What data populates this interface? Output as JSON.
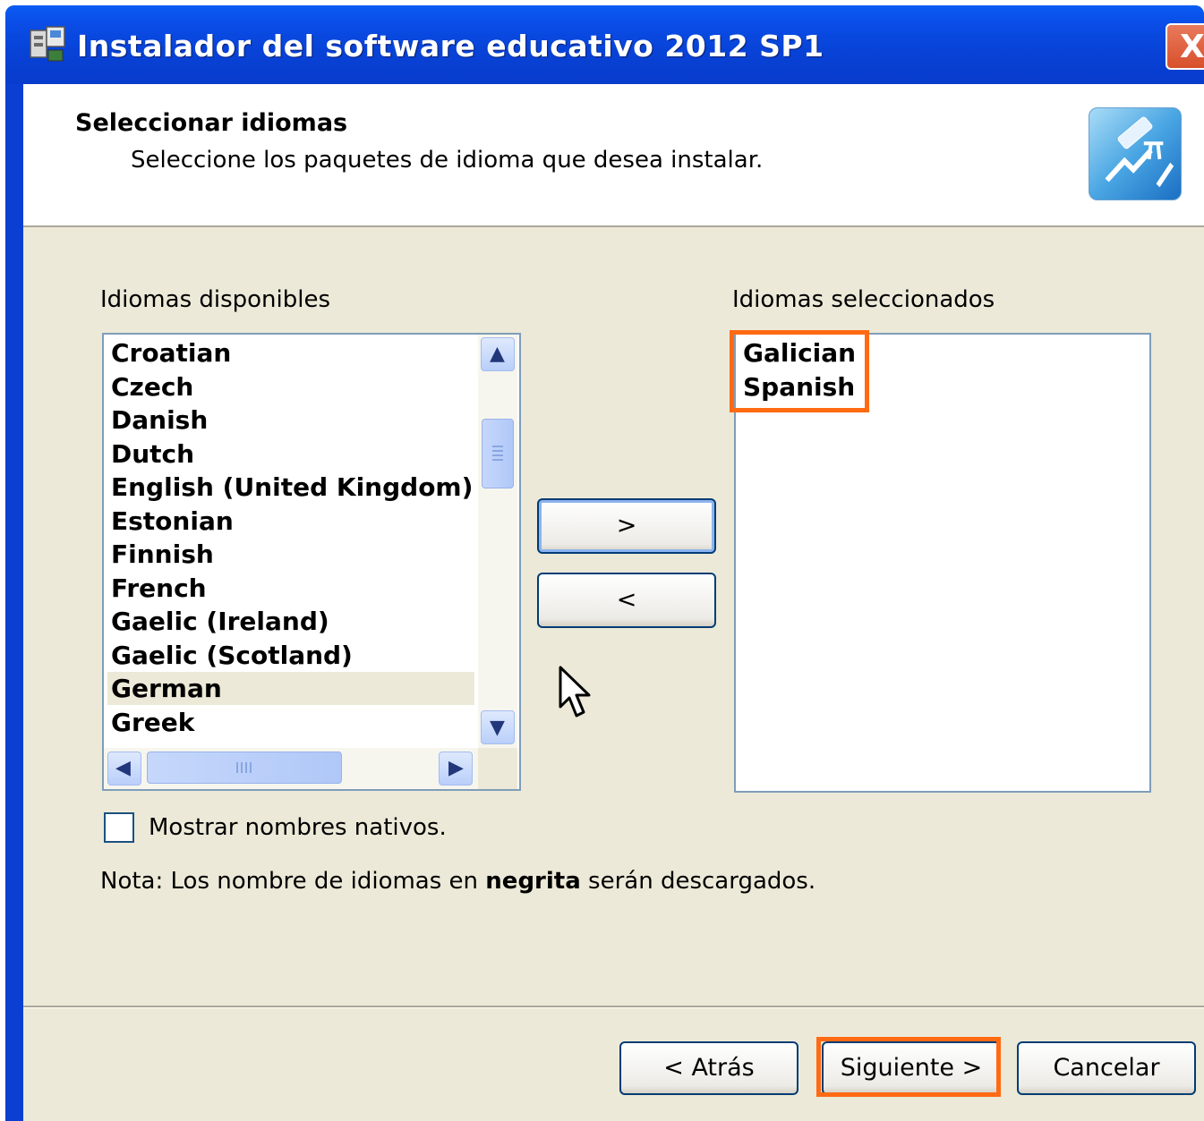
{
  "window": {
    "title": "Instalador del software educativo 2012 SP1",
    "close_symbol": "X"
  },
  "header": {
    "title": "Seleccionar idiomas",
    "subtitle": "Seleccione los paquetes de idioma que desea instalar.",
    "logo_icon": "education-tools-icon"
  },
  "available": {
    "label": "Idiomas disponibles",
    "items": [
      "Croatian",
      "Czech",
      "Danish",
      "Dutch",
      "English (United Kingdom)",
      "Estonian",
      "Finnish",
      "French",
      "Gaelic (Ireland)",
      "Gaelic (Scotland)",
      "German",
      "Greek"
    ],
    "selected_item": "German"
  },
  "selected": {
    "label": "Idiomas seleccionados",
    "items": [
      "Galician",
      "Spanish"
    ]
  },
  "move": {
    "add_label": ">",
    "remove_label": "<"
  },
  "options": {
    "native_names_label": "Mostrar nombres nativos.",
    "native_names_checked": false
  },
  "note": {
    "prefix": "Nota: Los nombre de idiomas en ",
    "bold": "negrita",
    "suffix": " serán descargados."
  },
  "footer": {
    "back_label": "< Atrás",
    "next_label": "Siguiente >",
    "cancel_label": "Cancelar"
  },
  "colors": {
    "title_bar": "#0a4ee8",
    "highlight": "#ff6a13",
    "dialog_bg": "#ece9d8"
  }
}
